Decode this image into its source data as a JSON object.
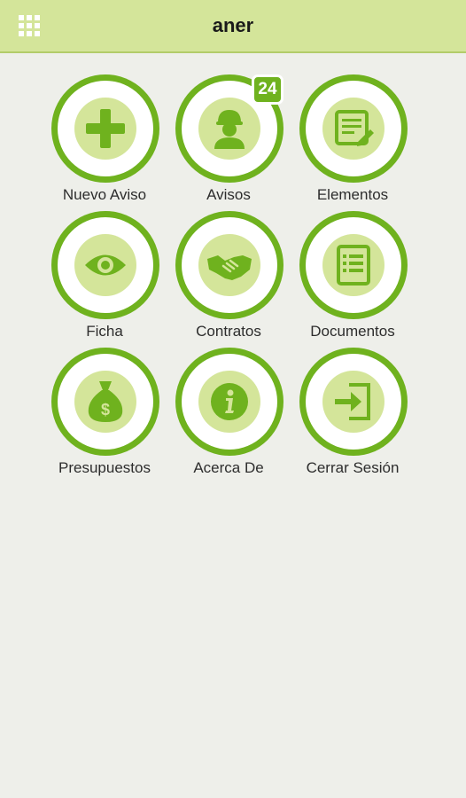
{
  "app": {
    "title": "aner",
    "menu_icon": "grid-menu-icon"
  },
  "colors": {
    "header_bg": "#d4e59a",
    "accent_green": "#6fb21e",
    "icon_disc": "#d4e59a",
    "background": "#eeefea"
  },
  "tiles": [
    {
      "label": "Nuevo Aviso",
      "icon": "plus-icon"
    },
    {
      "label": "Avisos",
      "icon": "worker-icon",
      "badge": "24"
    },
    {
      "label": "Elementos",
      "icon": "edit-list-icon"
    },
    {
      "label": "Ficha",
      "icon": "eye-icon"
    },
    {
      "label": "Contratos",
      "icon": "handshake-icon"
    },
    {
      "label": "Documentos",
      "icon": "document-icon"
    },
    {
      "label": "Presupuestos",
      "icon": "money-bag-icon"
    },
    {
      "label": "Acerca De",
      "icon": "info-icon"
    },
    {
      "label": "Cerrar Sesión",
      "icon": "logout-icon"
    }
  ]
}
